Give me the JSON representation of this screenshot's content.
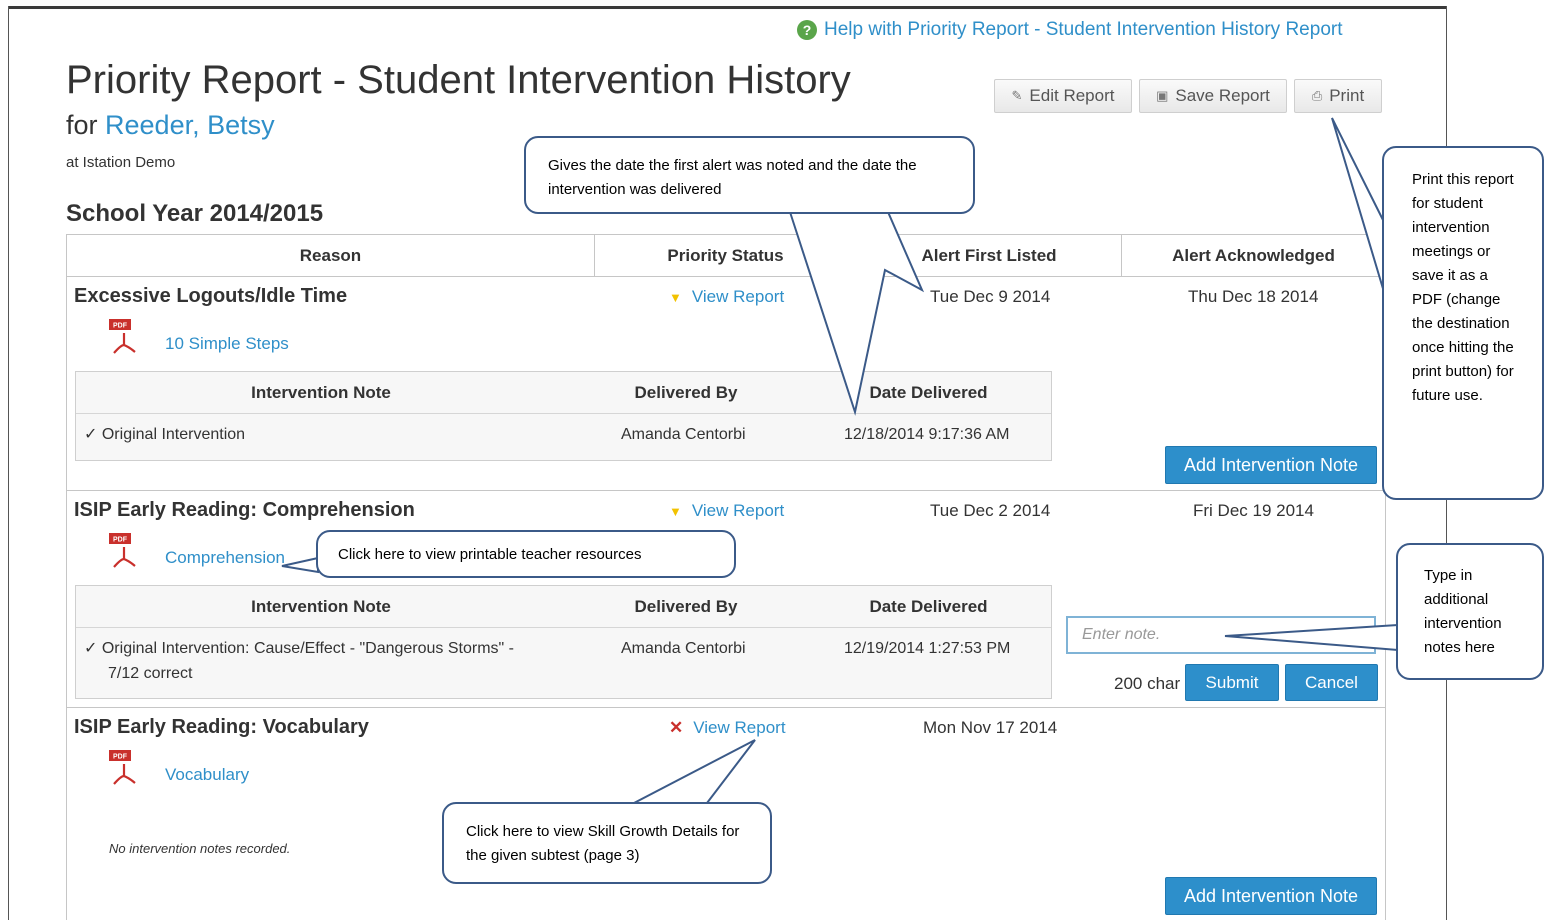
{
  "help": {
    "label": "Help with Priority Report - Student Intervention History Report"
  },
  "header": {
    "title": "Priority Report - Student Intervention History",
    "for_prefix": "for",
    "student": "Reeder, Betsy",
    "at_line": "at Istation Demo",
    "school_year": "School Year 2014/2015"
  },
  "toolbar": {
    "edit": "Edit Report",
    "save": "Save Report",
    "print": "Print"
  },
  "table": {
    "headers": [
      "Reason",
      "Priority Status",
      "Alert First Listed",
      "Alert Acknowledged"
    ],
    "note_headers": [
      "Intervention Note",
      "Delivered By",
      "Date Delivered"
    ],
    "view_report": "View Report",
    "add_note": "Add Intervention Note",
    "rows": [
      {
        "reason": "Excessive Logouts/Idle Time",
        "status_icon": "down-triangle-icon",
        "first_listed": "Tue Dec 9 2014",
        "acknowledged": "Thu Dec 18 2014",
        "resource": "10 Simple Steps",
        "notes": [
          {
            "text": "Original Intervention",
            "by": "Amanda Centorbi",
            "date": "12/18/2014 9:17:36 AM"
          }
        ]
      },
      {
        "reason": "ISIP Early Reading: Comprehension",
        "status_icon": "down-triangle-icon",
        "first_listed": "Tue Dec 2 2014",
        "acknowledged": "Fri Dec 19 2014",
        "resource": "Comprehension",
        "notes": [
          {
            "text_line1": "Original Intervention: Cause/Effect - \"Dangerous Storms\" -",
            "text_line2": "7/12 correct",
            "by": "Amanda Centorbi",
            "date": "12/19/2014 1:27:53 PM"
          }
        ]
      },
      {
        "reason": "ISIP Early Reading: Vocabulary",
        "status_icon": "x-icon",
        "first_listed": "Mon Nov 17 2014",
        "acknowledged": "",
        "resource": "Vocabulary",
        "no_notes": "No intervention notes recorded."
      }
    ]
  },
  "note_form": {
    "placeholder": "Enter note.",
    "char_count": "200 char",
    "submit": "Submit",
    "cancel": "Cancel"
  },
  "callouts": {
    "dates": "Gives the date the first alert was noted and the date the intervention was delivered",
    "print": "Print this report for student intervention meetings or save it as a PDF (change the destination once hitting the print button) for future use.",
    "resources": "Click here to view printable teacher resources",
    "notes": "Type in additional intervention notes here",
    "skill": "Click here to view Skill Growth Details for the given subtest (page 3)"
  },
  "colors": {
    "link": "#2f8fc9",
    "button_blue": "#2d8fcb",
    "callout_border": "#3b5a88",
    "warning": "#f2c200",
    "error": "#c9302c"
  }
}
